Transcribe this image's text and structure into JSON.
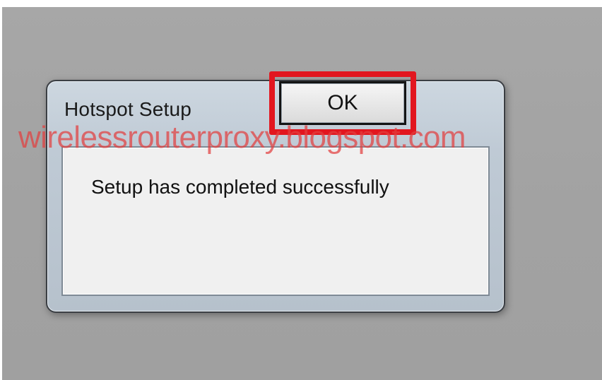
{
  "dialog": {
    "title": "Hotspot Setup",
    "message": "Setup has completed successfully",
    "ok_label": "OK"
  },
  "overlay": {
    "watermark": "wirelessrouterproxy.blogspot.com",
    "highlight_color": "#e2161f"
  }
}
